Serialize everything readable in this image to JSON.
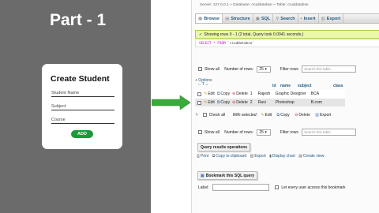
{
  "left": {
    "part_title": "Part - 1",
    "form": {
      "title": "Create Student",
      "student_name": "Student Name",
      "subject": "Subject",
      "course": "Course",
      "add_button": "ADD"
    }
  },
  "pma": {
    "breadcrumb": "Server: 127.0.0.1 » Database: cruddatabse » Table: cruddatabse",
    "tabs": [
      {
        "icon": "browse",
        "label": "Browse"
      },
      {
        "icon": "structure",
        "label": "Structure"
      },
      {
        "icon": "sql",
        "label": "SQL"
      },
      {
        "icon": "search",
        "label": "Search"
      },
      {
        "icon": "insert",
        "label": "Insert"
      },
      {
        "icon": "export",
        "label": "Export"
      }
    ],
    "success_msg": "Showing rows 0 - 1 (2 total, Query took 0.0041 seconds.)",
    "sql": {
      "select": "SELECT",
      "star_from": "* FROM",
      "table": "`cruddatabse`"
    },
    "nav": {
      "show_all": "Show all",
      "number_of_rows": "Number of rows:",
      "rows_value": "25",
      "filter_rows": "Filter rows",
      "filter_placeholder": "Search this table"
    },
    "options": "+ Options",
    "sort_arrows": "←T→",
    "table": {
      "columns": [
        "id",
        "name",
        "subject",
        "class"
      ],
      "actions": {
        "edit": "Edit",
        "copy": "Copy",
        "delete": "Delete"
      },
      "rows": [
        {
          "id": "1",
          "name": "Rajesh",
          "subject": "Graphic Designer",
          "class": "BCA"
        },
        {
          "id": "2",
          "name": "Ravi",
          "subject": "Photoshop",
          "class": "B.com"
        }
      ]
    },
    "with_selected": {
      "check_all": "Check all",
      "label": "With selected:",
      "edit": "Edit",
      "copy": "Copy",
      "delete": "Delete",
      "export": "Export"
    },
    "qro": {
      "title": "Query results operations",
      "print": "Print",
      "copy_clipboard": "Copy to clipboard",
      "export": "Export",
      "display_chart": "Display chart",
      "create_view": "Create view"
    },
    "bookmark": {
      "title": "Bookmark this SQL query",
      "label": "Label:",
      "let_every_user": "Let every user access this bookmark"
    }
  },
  "colors": {
    "success_bg": "#ebf8a4",
    "add_button": "#1a9a3a",
    "arrow": "#3aaa3a"
  }
}
